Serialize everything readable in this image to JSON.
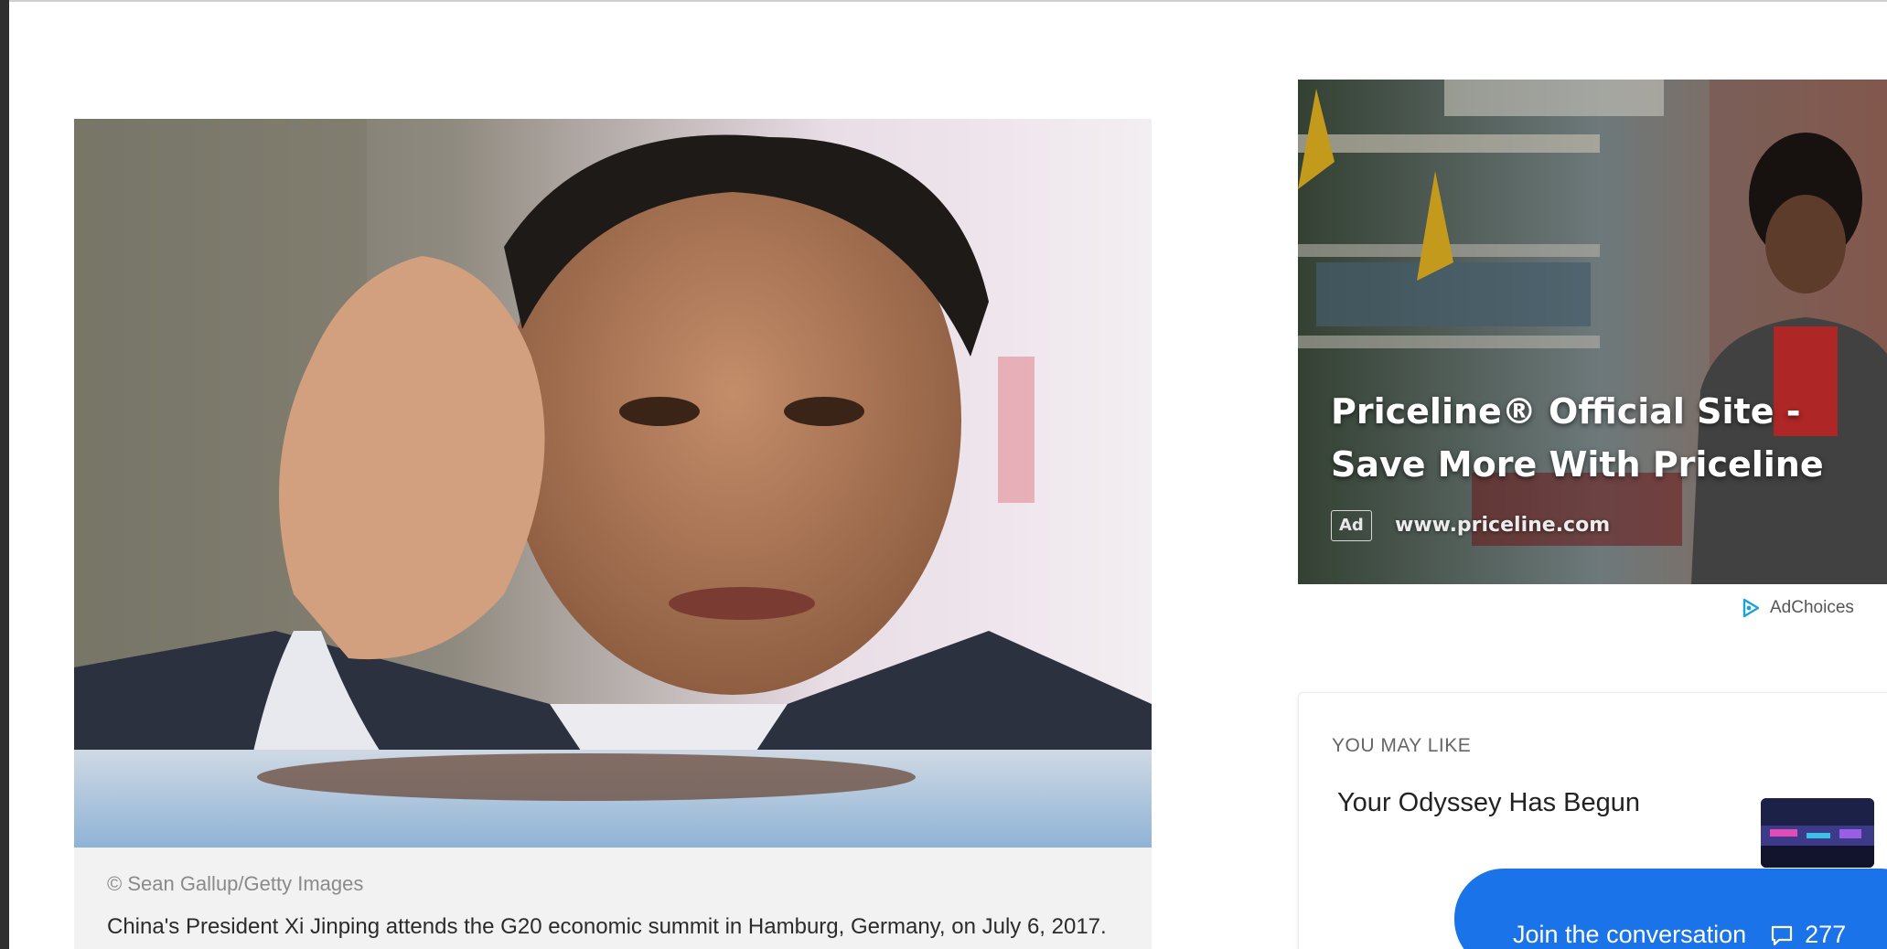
{
  "figure": {
    "credit": "© Sean Gallup/Getty Images",
    "caption": "China's President Xi Jinping attends the G20 economic summit in Hamburg, Germany, on July 6, 2017. As Russia's invasion of Ukraine entered its fourth week, China's Vice Foreign Minister"
  },
  "ad": {
    "title": "Priceline® Official Site - Save More With Priceline",
    "badge": "Ad",
    "url": "www.priceline.com",
    "choices_label": "AdChoices"
  },
  "may_like": {
    "heading": "YOU MAY LIKE",
    "items": [
      {
        "title": "Your Odyssey Has Begun"
      }
    ]
  },
  "conversation": {
    "label": "Join the conversation",
    "count": "277"
  },
  "colors": {
    "accent": "#1a73e8",
    "caption_bg": "#f2f2f2",
    "rail": "#2f2f2f"
  },
  "icons": {
    "ad_choices": "adchoices-triangle-icon",
    "comments": "comment-bubble-icon"
  }
}
